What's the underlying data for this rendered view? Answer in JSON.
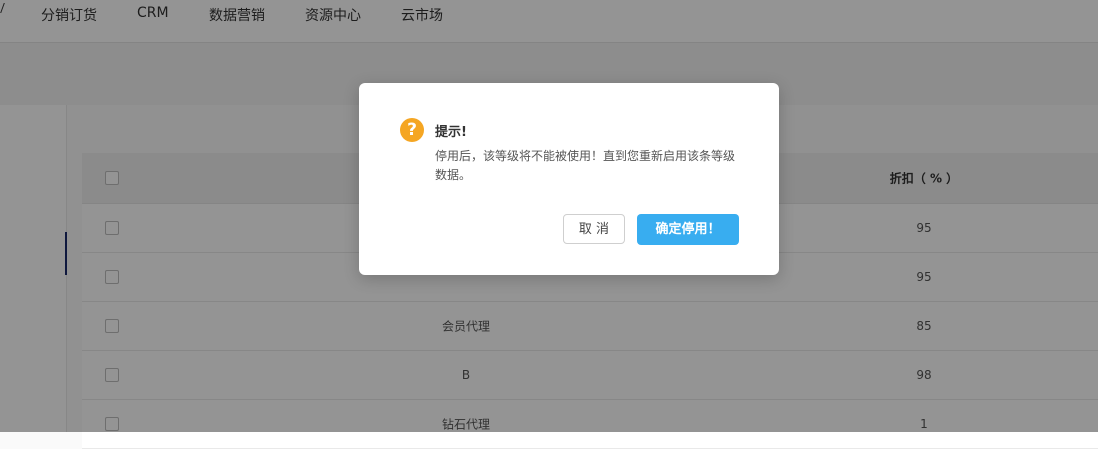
{
  "nav": {
    "items": [
      "分销订货",
      "CRM",
      "数据营销",
      "资源中心",
      "云市场"
    ]
  },
  "table": {
    "header": {
      "discount": "折扣（ % ）"
    },
    "rows": [
      {
        "name": "",
        "discount": "95"
      },
      {
        "name": "",
        "discount": "95"
      },
      {
        "name": "会员代理",
        "discount": "85"
      },
      {
        "name": "B",
        "discount": "98"
      },
      {
        "name": "钻石代理",
        "discount": "1"
      }
    ]
  },
  "dialog": {
    "icon": "question-icon",
    "title": "提示!",
    "message": "停用后，该等级将不能被使用！直到您重新启用该条等级数据。",
    "cancel_label": "取 消",
    "confirm_label": "确定停用！"
  },
  "colors": {
    "confirm": "#38adf0",
    "warning_icon": "#f5a623",
    "sidebar_active": "#1a2a6c"
  }
}
